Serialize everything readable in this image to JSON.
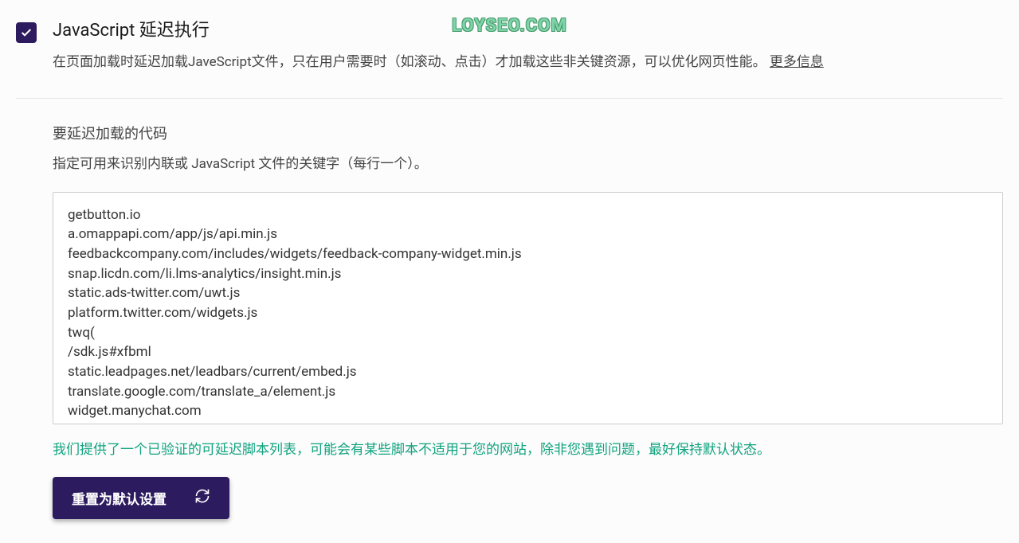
{
  "watermark": "LOYSEO.COM",
  "header": {
    "title": "JavaScript 延迟执行",
    "description": "在页面加载时延迟加载JaveScript文件，只在用户需要时（如滚动、点击）才加载这些非关键资源，可以优化网页性能。",
    "moreInfoLabel": "更多信息"
  },
  "body": {
    "sectionTitle": "要延迟加载的代码",
    "sectionDescription": "指定可用来识别内联或 JavaScript 文件的关键字（每行一个）。",
    "textareaContent": "getbutton.io\na.omappapi.com/app/js/api.min.js\nfeedbackcompany.com/includes/widgets/feedback-company-widget.min.js\nsnap.licdn.com/li.lms-analytics/insight.min.js\nstatic.ads-twitter.com/uwt.js\nplatform.twitter.com/widgets.js\ntwq(\n/sdk.js#xfbml\nstatic.leadpages.net/leadbars/current/embed.js\ntranslate.google.com/translate_a/element.js\nwidget.manychat.com\nxfbml.customerchat.js",
    "infoText": "我们提供了一个已验证的可延迟脚本列表，可能会有某些脚本不适用于您的网站，除非您遇到问题，最好保持默认状态。",
    "resetButtonLabel": "重置为默认设置"
  }
}
